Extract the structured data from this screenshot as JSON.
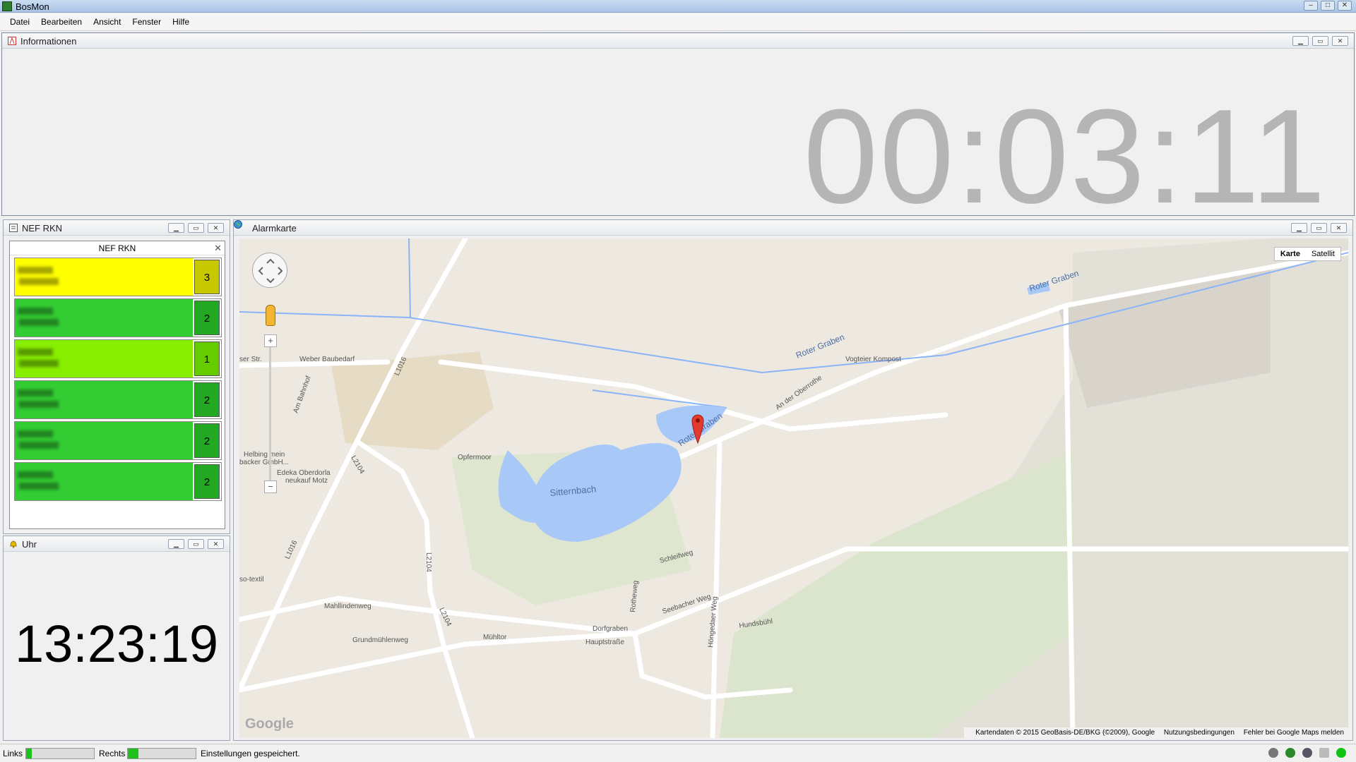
{
  "window": {
    "title": "BosMon",
    "minimize": "–",
    "maximize": "□",
    "close": "✕"
  },
  "menu": [
    "Datei",
    "Bearbeiten",
    "Ansicht",
    "Fenster",
    "Hilfe"
  ],
  "info_panel": {
    "title": "Informationen",
    "elapsed": "00:03:11"
  },
  "nef_panel": {
    "title": "NEF RKN",
    "list_title": "NEF RKN",
    "units": [
      {
        "status": "3",
        "color": "#ffff00",
        "status_color": "#c8c800"
      },
      {
        "status": "2",
        "color": "#33cc33",
        "status_color": "#22a822"
      },
      {
        "status": "1",
        "color": "#88ee00",
        "status_color": "#66cc00"
      },
      {
        "status": "2",
        "color": "#33cc33",
        "status_color": "#22a822"
      },
      {
        "status": "2",
        "color": "#33cc33",
        "status_color": "#22a822"
      },
      {
        "status": "2",
        "color": "#33cc33",
        "status_color": "#22a822"
      }
    ]
  },
  "clock_panel": {
    "title": "Uhr",
    "time": "13:23:19"
  },
  "map_panel": {
    "title": "Alarmkarte",
    "map_type": {
      "map": "Karte",
      "satellite": "Satellit"
    },
    "labels": {
      "roter_graben_1": "Roter Graben",
      "roter_graben_2": "Roter Graben",
      "roter_graben_3": "Roter Graben",
      "vogteier": "Vogteier Kompost",
      "weber": "Weber Baubedarf",
      "str": "ser Str.",
      "l1016a": "L1016",
      "l1016b": "L1016",
      "l2104a": "L2104",
      "l2104b": "L2104",
      "l2104c": "L2104",
      "am_bahnhof": "Am Bahnhof",
      "an_der": "An der Oberrothe",
      "opfermoor": "Opfermoor",
      "sitternbach": "Sitternbach",
      "helbing1": "Helbing mein",
      "helbing2": "backer GmbH...",
      "edeka1": "Edeka Oberdorla",
      "edeka2": "neukauf Motz",
      "textil": "so-textil",
      "mahllinden": "Mahllindenweg",
      "grundmuehlen": "Grundmühlenweg",
      "muehltor": "Mühltor",
      "dorfgraben": "Dorfgraben",
      "haupt": "Hauptstraße",
      "schleif": "Schleifweg",
      "seebacher": "Seebacher Weg",
      "rotheweg": "Rotheweg",
      "hoengeda": "Höngedaer Weg",
      "hundsbuehl": "Hundsbühl"
    },
    "zoom_in": "+",
    "zoom_out": "−",
    "copyright": "Kartendaten © 2015 GeoBasis-DE/BKG (©2009), Google",
    "terms": "Nutzungsbedingungen",
    "report": "Fehler bei Google Maps melden",
    "logo": "Google"
  },
  "statusbar": {
    "left_label": "Links",
    "right_label": "Rechts",
    "message": "Einstellungen gespeichert."
  }
}
